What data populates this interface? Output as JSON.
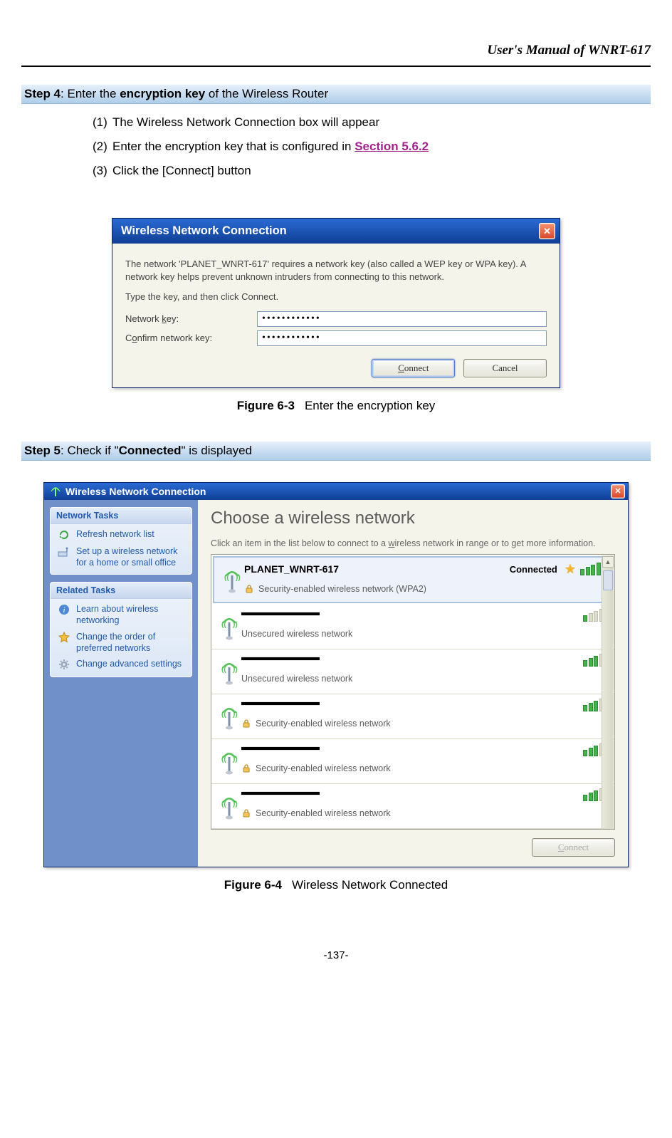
{
  "doc": {
    "header": "User's Manual of WNRT-617",
    "page_number": "-137-"
  },
  "step4": {
    "label_strong": "Step 4",
    "label_rest": ": Enter the ",
    "keyword": "encryption key",
    "label_tail": " of the Wireless Router",
    "items": [
      {
        "num": "(1)",
        "text": "The Wireless Network Connection box will appear"
      },
      {
        "num": "(2)",
        "text_pre": "Enter the encryption key that is configured in ",
        "link": "Section 5.6.2"
      },
      {
        "num": "(3)",
        "text": "Click the [Connect] button"
      }
    ]
  },
  "dlg1": {
    "title": "Wireless Network Connection",
    "msg1": "The network 'PLANET_WNRT-617' requires a network key (also called a WEP key or WPA key). A network key helps prevent unknown intruders from connecting to this network.",
    "msg2": "Type the key, and then click Connect.",
    "label_key_pre": "Network ",
    "label_key_u": "k",
    "label_key_post": "ey:",
    "label_conf_pre": "C",
    "label_conf_u": "o",
    "label_conf_post": "nfirm network key:",
    "value_key": "••••••••••••",
    "value_conf": "••••••••••••",
    "btn_connect_pre": "",
    "btn_connect_u": "C",
    "btn_connect_post": "onnect",
    "btn_cancel": "Cancel"
  },
  "fig63": {
    "label": "Figure 6-3",
    "caption": "Enter the encryption key"
  },
  "step5": {
    "label_strong": "Step 5",
    "label_rest": ": Check if \"",
    "keyword": "Connected",
    "label_tail": "\" is displayed"
  },
  "dlg2": {
    "title": "Wireless Network Connection",
    "tasks": {
      "h1": "Network Tasks",
      "items": [
        {
          "icon": "refresh-icon",
          "text": "Refresh network list"
        },
        {
          "icon": "setup-icon",
          "text": "Set up a wireless network for a home or small office"
        }
      ]
    },
    "related": {
      "h1": "Related Tasks",
      "items": [
        {
          "icon": "info-icon",
          "text": "Learn about wireless networking"
        },
        {
          "icon": "star-icon",
          "text": "Change the order of preferred networks"
        },
        {
          "icon": "gear-icon",
          "text": "Change advanced settings"
        }
      ]
    },
    "choose_heading": "Choose a wireless network",
    "choose_sub_pre": "Click an item in the list below to connect to a ",
    "choose_sub_u": "w",
    "choose_sub_post": "ireless network in range or to get more information.",
    "networks": [
      {
        "name": "PLANET_WNRT-617",
        "redacted": false,
        "sec": "Security-enabled wireless network (WPA2)",
        "lock": true,
        "bars": 5,
        "connected": true,
        "selected": true
      },
      {
        "name": "",
        "redacted": true,
        "sec": "Unsecured wireless network",
        "lock": false,
        "bars": 1
      },
      {
        "name": "",
        "redacted": true,
        "sec": "Unsecured wireless network",
        "lock": false,
        "bars": 3
      },
      {
        "name": "",
        "redacted": true,
        "sec": "Security-enabled wireless network",
        "lock": true,
        "bars": 3
      },
      {
        "name": "",
        "redacted": true,
        "sec": "Security-enabled wireless network",
        "lock": true,
        "bars": 3
      },
      {
        "name": "",
        "redacted": true,
        "sec": "Security-enabled wireless network",
        "lock": true,
        "bars": 3
      }
    ],
    "connected_label": "Connected",
    "connect_btn_u": "C",
    "connect_btn_post": "onnect"
  },
  "fig64": {
    "label": "Figure 6-4",
    "caption": "Wireless Network Connected"
  }
}
